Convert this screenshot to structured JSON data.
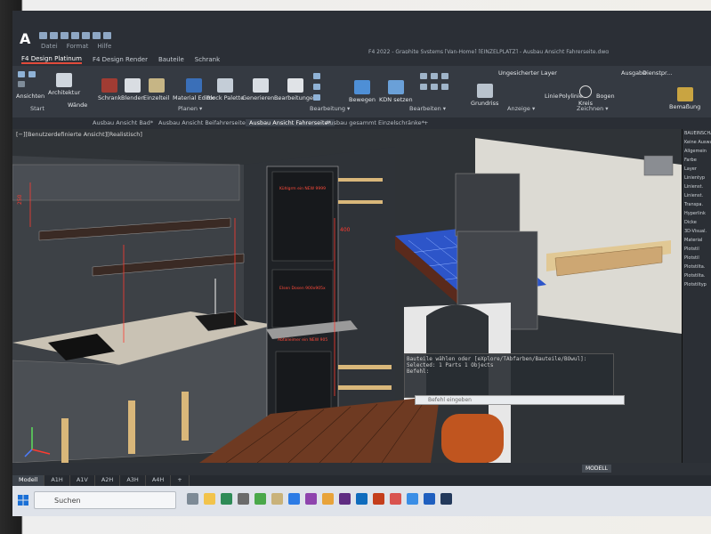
{
  "app": {
    "logo": "A",
    "menu": [
      "Datei",
      "Format",
      "Hilfe"
    ],
    "title": "F4 2022 - Graphite Systems  [Van-Home] [EINZELPLATZ] - Ausbau Ansicht Fahrerseite.dwg"
  },
  "ribbon_tabs": [
    {
      "label": "F4 Design Platinum",
      "active": true
    },
    {
      "label": "F4 Design Render",
      "active": false
    },
    {
      "label": "Bauteile",
      "active": false
    },
    {
      "label": "Schrank",
      "active": false
    }
  ],
  "ribbon_buttons": {
    "ansichten": "Ansichten",
    "waende": "Wände",
    "architektur": "Architektur",
    "schrank": "Schrank",
    "blenden": "Blenden",
    "einzelteil": "Einzelteil",
    "material_editor": "Material Editor",
    "block_palette": "Block Palette",
    "generieren": "Generieren...",
    "bearbeitungen": "Bearbeitungen",
    "bewegen": "Bewegen",
    "kdn_setzen": "KDN setzen",
    "grundriss": "Grundriss",
    "layer": "Ungesicherter Layer",
    "linie": "Linie",
    "polylinie": "Polylinie",
    "kreis": "Kreis",
    "bogen": "Bogen",
    "ausgabe": "Ausgabe",
    "dienstpr": "Dienstpr...",
    "bemassung": "Bemaßung"
  },
  "ribbon_groups": {
    "start": "Start",
    "planen": "Planen ▾",
    "bearbeitung": "Bearbeitung ▾",
    "bearbeiten": "Bearbeiten ▾",
    "anzeige": "Anzeige ▾",
    "zeichnen": "Zeichnen ▾"
  },
  "doc_tabs": [
    {
      "label": "Ausbau Ansicht Bad*",
      "current": false
    },
    {
      "label": "Ausbau Ansicht Beifahrerseite*",
      "current": false
    },
    {
      "label": "Ausbau Ansicht Fahrerseite*",
      "current": true
    },
    {
      "label": "Ausbau gesammt Einzelschränke*",
      "current": false
    }
  ],
  "viewport": {
    "label": "[−][Benutzerdefinierte Ansicht][Realistisch]",
    "annotation_top": "Kühlgrm ein NEW 9999",
    "annotation_mid": "Elsen Dosen 900x905x",
    "annotation_bottom": "Abfalleimer ein NEW 905",
    "dim_250": "250",
    "dim_400": "400"
  },
  "command_line": {
    "line1": "Bauteile wählen oder [eXplore/TAbfarben/Bauteile/BOwul]:",
    "line2": "Selected: 1 Parts 1 Objects",
    "line3": "Befehl:",
    "placeholder": "Befehl eingeben"
  },
  "right_panel": [
    "BAUEINSCHA...",
    "Keine Auswa...",
    "Allgemein",
    "Farbe",
    "Layer",
    "Linientyp",
    "Linienst.",
    "Linienst.",
    "Transpa.",
    "Hyperlink",
    "Dicke",
    "3D-Visual.",
    "Material",
    "Plotstil",
    "Plotstil",
    "Plotstilta.",
    "Plotstilta.",
    "Plotstiltyp"
  ],
  "status": {
    "model": "MODELL"
  },
  "layout_tabs": [
    {
      "label": "Modell",
      "current": true
    },
    {
      "label": "A1H",
      "current": false
    },
    {
      "label": "A1V",
      "current": false
    },
    {
      "label": "A2H",
      "current": false
    },
    {
      "label": "A3H",
      "current": false
    },
    {
      "label": "A4H",
      "current": false
    },
    {
      "label": "+",
      "current": false
    }
  ],
  "taskbar": {
    "search_placeholder": "Suchen"
  },
  "colors": {
    "accent": "#e14b3b",
    "ribbon_bg": "#353a42",
    "viewport_bg": "#2f3337",
    "wood": "#6e3a22",
    "floor_tile": "#2d55c9"
  }
}
